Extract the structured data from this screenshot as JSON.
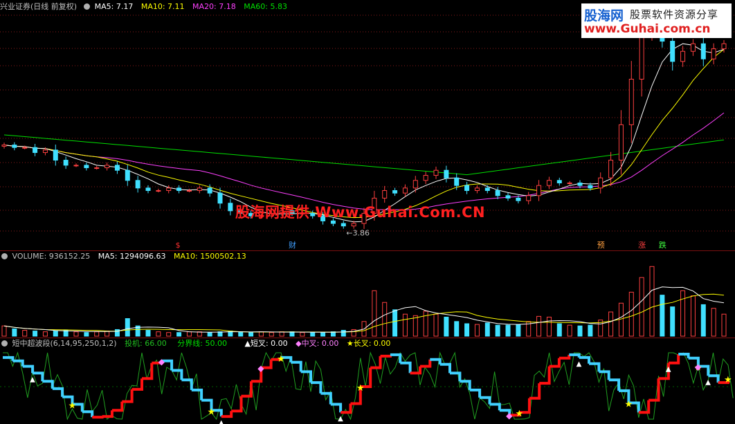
{
  "chart_data": [
    {
      "type": "candlestick",
      "stock_name": "兴业证券",
      "period": "(日线 前复权)",
      "indicators": [
        {
          "label": "MA5:",
          "value": "7.17",
          "color": "#ffffff"
        },
        {
          "label": "MA10:",
          "value": "7.11",
          "color": "#ffff00"
        },
        {
          "label": "MA20:",
          "value": "7.18",
          "color": "#ff40ff"
        },
        {
          "label": "MA60:",
          "value": "5.83",
          "color": "#00e000"
        }
      ],
      "low_label": "3.86",
      "markers": [
        "$",
        "财",
        "预",
        "涨",
        "跌"
      ],
      "close_series": [
        7.2,
        7.1,
        7.1,
        6.9,
        7.0,
        6.6,
        6.4,
        6.4,
        6.3,
        6.3,
        6.4,
        6.2,
        5.8,
        5.5,
        5.4,
        5.4,
        5.5,
        5.4,
        5.4,
        5.5,
        5.3,
        4.9,
        4.6,
        4.5,
        4.4,
        4.4,
        4.5,
        4.6,
        4.5,
        4.5,
        4.4,
        4.2,
        4.1,
        4.0,
        4.1,
        4.5,
        5.1,
        5.4,
        5.3,
        5.5,
        5.8,
        6.0,
        6.2,
        5.9,
        5.6,
        5.4,
        5.5,
        5.4,
        5.2,
        5.1,
        5.0,
        5.2,
        5.6,
        5.8,
        5.7,
        5.7,
        5.6,
        5.5,
        5.9,
        6.6,
        8.0,
        9.8,
        11.5,
        11.8,
        11.3,
        10.5,
        10.9,
        11.2,
        10.6,
        11.0,
        11.2
      ]
    },
    {
      "type": "bar",
      "title": "VOLUME:",
      "value": "936152.25",
      "ma5_label": "MA5:",
      "ma5": "1294096.63",
      "ma10_label": "MA10:",
      "ma10": "1500502.13",
      "values": [
        0.14,
        0.1,
        0.08,
        0.07,
        0.06,
        0.07,
        0.08,
        0.06,
        0.05,
        0.06,
        0.07,
        0.09,
        0.24,
        0.14,
        0.08,
        0.06,
        0.05,
        0.05,
        0.06,
        0.06,
        0.05,
        0.06,
        0.07,
        0.06,
        0.05,
        0.06,
        0.05,
        0.06,
        0.06,
        0.05,
        0.05,
        0.05,
        0.06,
        0.08,
        0.09,
        0.2,
        0.62,
        0.46,
        0.36,
        0.3,
        0.28,
        0.34,
        0.3,
        0.26,
        0.2,
        0.17,
        0.16,
        0.18,
        0.15,
        0.15,
        0.16,
        0.2,
        0.27,
        0.26,
        0.17,
        0.15,
        0.14,
        0.15,
        0.22,
        0.33,
        0.45,
        0.6,
        0.8,
        0.95,
        0.56,
        0.4,
        0.62,
        0.55,
        0.43,
        0.38,
        0.3
      ]
    },
    {
      "type": "line",
      "title": "短中超波段(6,14,95,250,1,2)",
      "series": [
        {
          "name": "投机:",
          "value": "66.00",
          "color": "#20c020"
        },
        {
          "name": "分界线:",
          "value": "50.00",
          "color": "#00e000"
        },
        {
          "name": "▲短叉:",
          "value": "0.00",
          "color": "#ffffff"
        },
        {
          "name": "◆中叉:",
          "value": "0.00",
          "color": "#ff80ff"
        },
        {
          "name": "★长叉:",
          "value": "0.00",
          "color": "#ffff00"
        }
      ],
      "wave_values": [
        0.93,
        0.88,
        0.8,
        0.7,
        0.58,
        0.47,
        0.35,
        0.24,
        0.13,
        0.05,
        0.06,
        0.15,
        0.28,
        0.46,
        0.62,
        0.85,
        0.88,
        0.74,
        0.6,
        0.45,
        0.3,
        0.15,
        0.06,
        0.14,
        0.36,
        0.58,
        0.78,
        0.9,
        0.93,
        0.86,
        0.72,
        0.56,
        0.4,
        0.24,
        0.12,
        0.25,
        0.5,
        0.78,
        0.95,
        0.97,
        0.85,
        0.7,
        0.8,
        0.9,
        0.83,
        0.7,
        0.58,
        0.45,
        0.34,
        0.24,
        0.15,
        0.08,
        0.12,
        0.33,
        0.55,
        0.8,
        0.92,
        0.97,
        0.93,
        0.84,
        0.72,
        0.6,
        0.44,
        0.26,
        0.12,
        0.3,
        0.62,
        0.85,
        0.98,
        0.92,
        0.8,
        0.66,
        0.56,
        0.62
      ]
    }
  ],
  "watermark": "股海网提供 Www.Guhai.Com.CN",
  "logo": {
    "brand": "股海网",
    "slogan": "股票软件资源分享",
    "url": "www.Guhai.com.cn"
  }
}
